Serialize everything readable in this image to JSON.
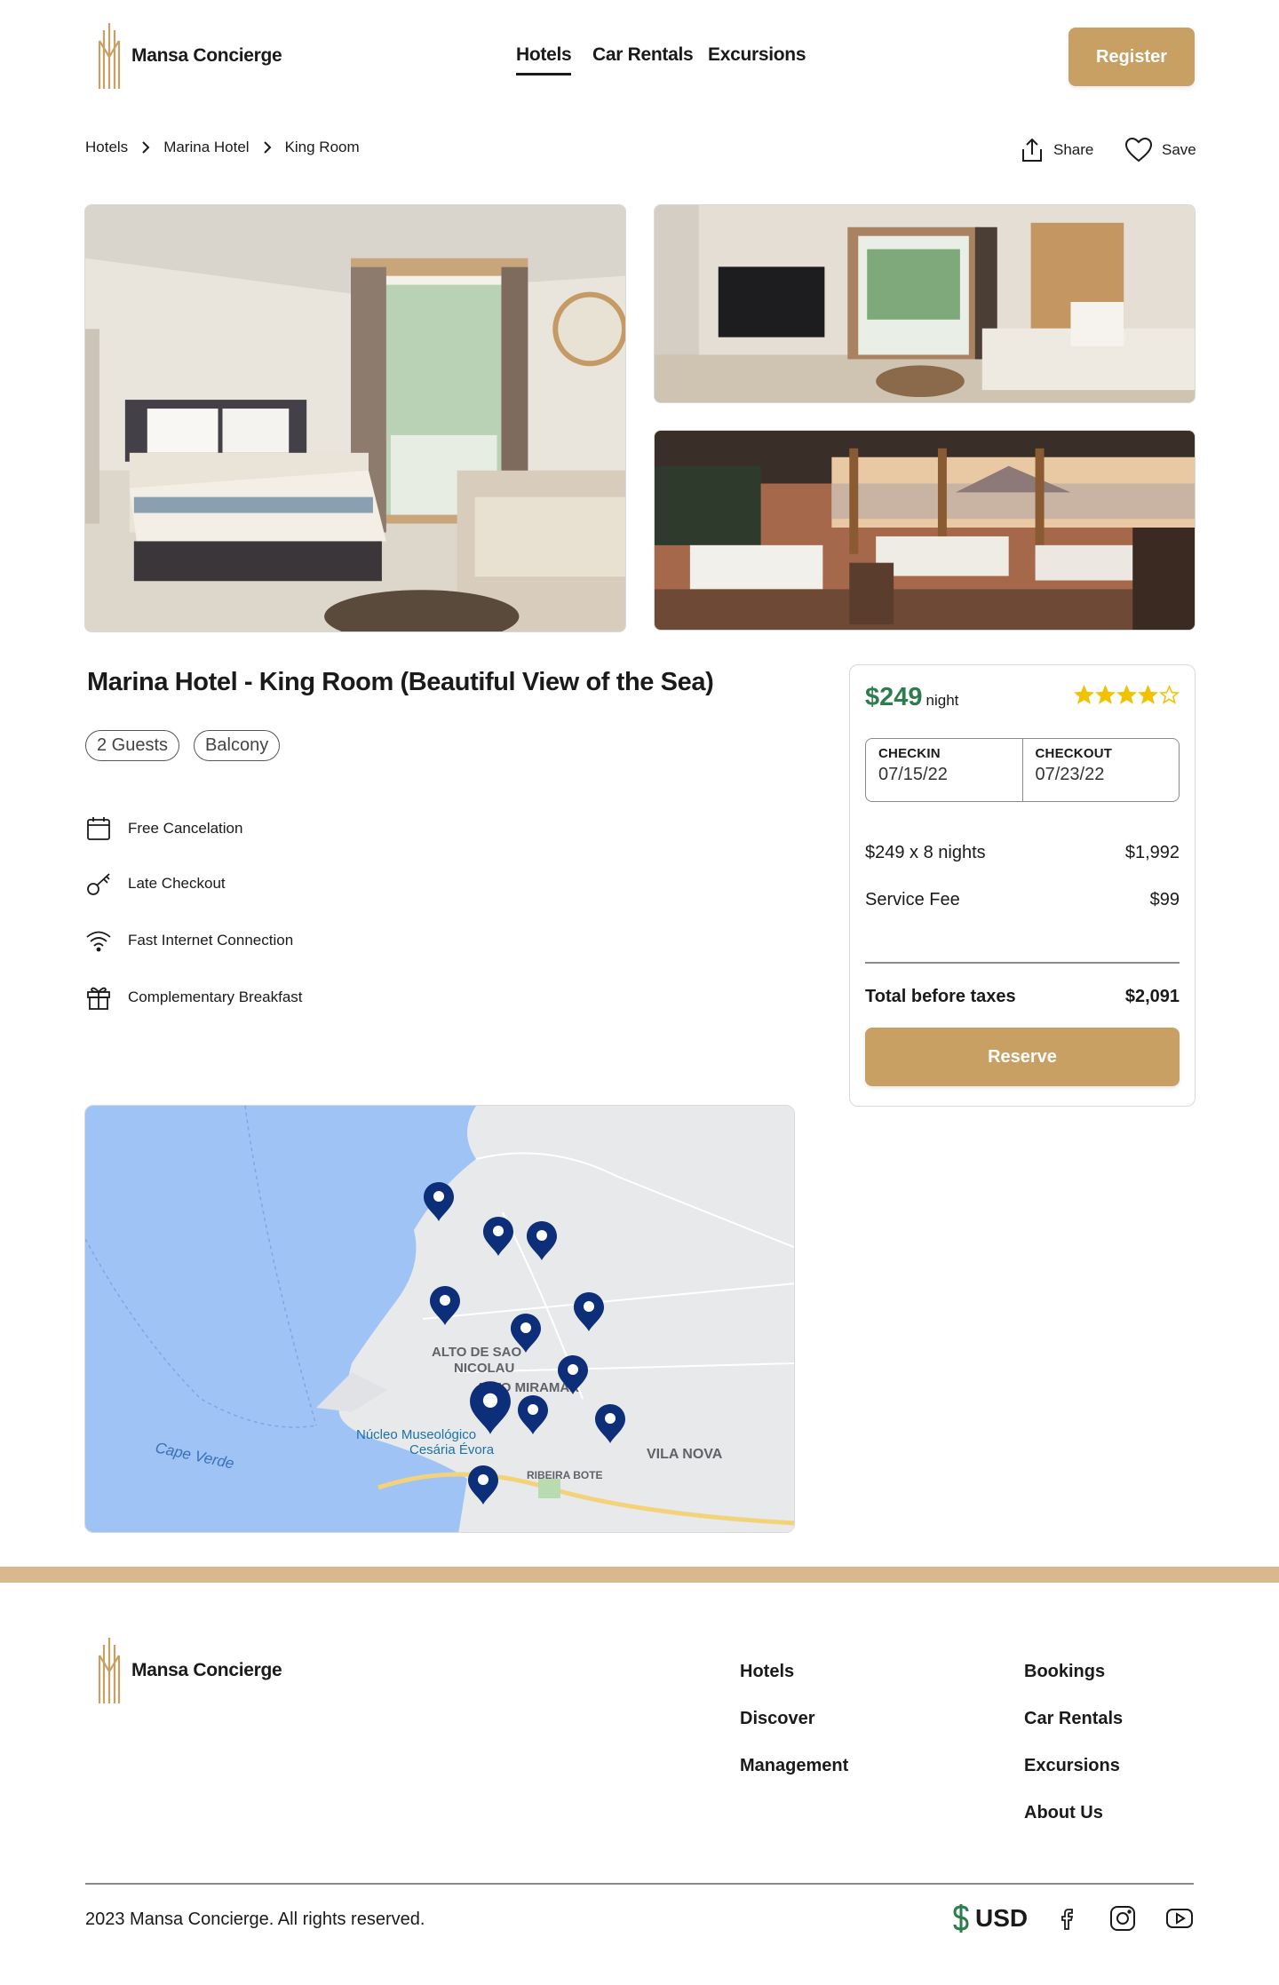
{
  "brand": {
    "name": "Mansa Concierge",
    "accent": "#c9a063",
    "price_color": "#2e7d4f"
  },
  "nav": {
    "items": [
      "Hotels",
      "Car Rentals",
      "Excursions"
    ],
    "active": "Hotels",
    "register": "Register"
  },
  "breadcrumb": [
    "Hotels",
    "Marina Hotel",
    "King Room"
  ],
  "actions": {
    "share": "Share",
    "save": "Save"
  },
  "listing": {
    "title": "Marina Hotel - King Room (Beautiful View of the Sea)",
    "tags": [
      "2 Guests",
      "Balcony"
    ],
    "amenities": [
      {
        "icon": "calendar-icon",
        "label": "Free Cancelation"
      },
      {
        "icon": "key-icon",
        "label": "Late Checkout"
      },
      {
        "icon": "wifi-icon",
        "label": "Fast Internet Connection"
      },
      {
        "icon": "gift-icon",
        "label": "Complementary Breakfast"
      }
    ]
  },
  "booking": {
    "price": "$249",
    "per": "night",
    "rating": 4,
    "rating_max": 5,
    "checkin_label": "CHECKIN",
    "checkin": "07/15/22",
    "checkout_label": "CHECKOUT",
    "checkout": "07/23/22",
    "lines": [
      {
        "label": "$249 x 8 nights",
        "value": "$1,992"
      },
      {
        "label": "Service Fee",
        "value": "$99"
      }
    ],
    "total_label": "Total before taxes",
    "total": "$2,091",
    "reserve": "Reserve"
  },
  "map": {
    "labels": {
      "alto1": "ALTO DE SAO",
      "alto2": "NICOLAU",
      "alto3": "ALTO MIRAMAR",
      "museu1": "Núcleo Museológico",
      "museu2": "Cesária Évora",
      "ribeira": "RIBEIRA BOTE",
      "vila": "VILA NOVA",
      "cape": "Cape Verde"
    }
  },
  "footer": {
    "col1": [
      "Hotels",
      "Discover",
      "Management"
    ],
    "col2": [
      "Bookings",
      "Car Rentals",
      "Excursions",
      "About Us"
    ],
    "copyright": "2023 Mansa Concierge. All rights reserved.",
    "currency": "USD",
    "social": [
      "facebook-icon",
      "instagram-icon",
      "youtube-icon"
    ]
  }
}
